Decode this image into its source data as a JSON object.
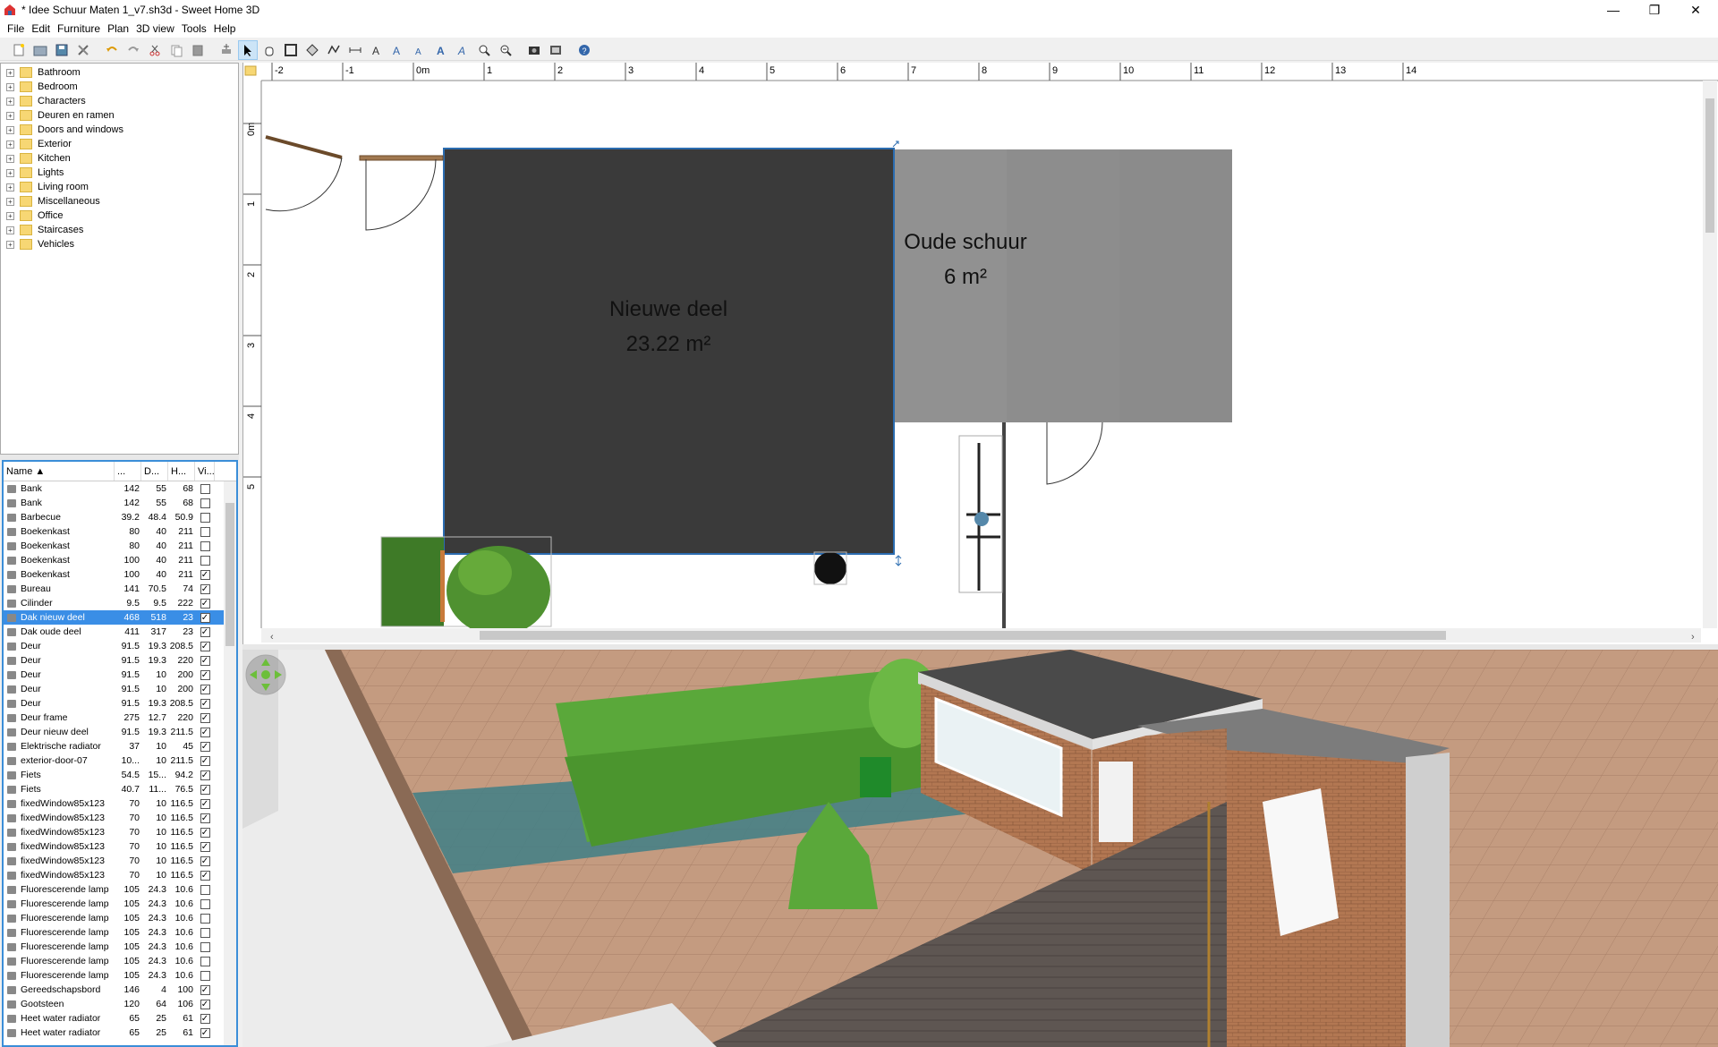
{
  "window": {
    "title": "* Idee Schuur Maten 1_v7.sh3d - Sweet Home 3D",
    "minimize": "—",
    "restore": "❐",
    "close": "✕"
  },
  "menu": [
    "File",
    "Edit",
    "Furniture",
    "Plan",
    "3D view",
    "Tools",
    "Help"
  ],
  "catalog": {
    "categories": [
      "Bathroom",
      "Bedroom",
      "Characters",
      "Deuren en ramen",
      "Doors and windows",
      "Exterior",
      "Kitchen",
      "Lights",
      "Living room",
      "Miscellaneous",
      "Office",
      "Staircases",
      "Vehicles"
    ]
  },
  "furniture_table": {
    "headers": [
      "Name ▲",
      "...",
      "D...",
      "H...",
      "Vi..."
    ],
    "rows": [
      {
        "name": "Bank",
        "w": "142",
        "d": "55",
        "h": "68",
        "visible": false
      },
      {
        "name": "Bank",
        "w": "142",
        "d": "55",
        "h": "68",
        "visible": false
      },
      {
        "name": "Barbecue",
        "w": "39.2",
        "d": "48.4",
        "h": "50.9",
        "visible": false
      },
      {
        "name": "Boekenkast",
        "w": "80",
        "d": "40",
        "h": "211",
        "visible": false
      },
      {
        "name": "Boekenkast",
        "w": "80",
        "d": "40",
        "h": "211",
        "visible": false
      },
      {
        "name": "Boekenkast",
        "w": "100",
        "d": "40",
        "h": "211",
        "visible": false
      },
      {
        "name": "Boekenkast",
        "w": "100",
        "d": "40",
        "h": "211",
        "visible": true
      },
      {
        "name": "Bureau",
        "w": "141",
        "d": "70.5",
        "h": "74",
        "visible": true
      },
      {
        "name": "Cilinder",
        "w": "9.5",
        "d": "9.5",
        "h": "222",
        "visible": true
      },
      {
        "name": "Dak nieuw deel",
        "w": "468",
        "d": "518",
        "h": "23",
        "visible": true,
        "selected": true
      },
      {
        "name": "Dak oude deel",
        "w": "411",
        "d": "317",
        "h": "23",
        "visible": true
      },
      {
        "name": "Deur",
        "w": "91.5",
        "d": "19.3",
        "h": "208.5",
        "visible": true
      },
      {
        "name": "Deur",
        "w": "91.5",
        "d": "19.3",
        "h": "220",
        "visible": true
      },
      {
        "name": "Deur",
        "w": "91.5",
        "d": "10",
        "h": "200",
        "visible": true
      },
      {
        "name": "Deur",
        "w": "91.5",
        "d": "10",
        "h": "200",
        "visible": true
      },
      {
        "name": "Deur",
        "w": "91.5",
        "d": "19.3",
        "h": "208.5",
        "visible": true
      },
      {
        "name": "Deur frame",
        "w": "275",
        "d": "12.7",
        "h": "220",
        "visible": true
      },
      {
        "name": "Deur nieuw deel",
        "w": "91.5",
        "d": "19.3",
        "h": "211.5",
        "visible": true
      },
      {
        "name": "Elektrische radiator",
        "w": "37",
        "d": "10",
        "h": "45",
        "visible": true
      },
      {
        "name": "exterior-door-07",
        "w": "10...",
        "d": "10",
        "h": "211.5",
        "visible": true
      },
      {
        "name": "Fiets",
        "w": "54.5",
        "d": "15...",
        "h": "94.2",
        "visible": true
      },
      {
        "name": "Fiets",
        "w": "40.7",
        "d": "11...",
        "h": "76.5",
        "visible": true
      },
      {
        "name": "fixedWindow85x123",
        "w": "70",
        "d": "10",
        "h": "116.5",
        "visible": true
      },
      {
        "name": "fixedWindow85x123",
        "w": "70",
        "d": "10",
        "h": "116.5",
        "visible": true
      },
      {
        "name": "fixedWindow85x123",
        "w": "70",
        "d": "10",
        "h": "116.5",
        "visible": true
      },
      {
        "name": "fixedWindow85x123",
        "w": "70",
        "d": "10",
        "h": "116.5",
        "visible": true
      },
      {
        "name": "fixedWindow85x123",
        "w": "70",
        "d": "10",
        "h": "116.5",
        "visible": true
      },
      {
        "name": "fixedWindow85x123",
        "w": "70",
        "d": "10",
        "h": "116.5",
        "visible": true
      },
      {
        "name": "Fluorescerende lamp",
        "w": "105",
        "d": "24.3",
        "h": "10.6",
        "visible": false
      },
      {
        "name": "Fluorescerende lamp",
        "w": "105",
        "d": "24.3",
        "h": "10.6",
        "visible": false
      },
      {
        "name": "Fluorescerende lamp",
        "w": "105",
        "d": "24.3",
        "h": "10.6",
        "visible": false
      },
      {
        "name": "Fluorescerende lamp",
        "w": "105",
        "d": "24.3",
        "h": "10.6",
        "visible": false
      },
      {
        "name": "Fluorescerende lamp",
        "w": "105",
        "d": "24.3",
        "h": "10.6",
        "visible": false
      },
      {
        "name": "Fluorescerende lamp",
        "w": "105",
        "d": "24.3",
        "h": "10.6",
        "visible": false
      },
      {
        "name": "Fluorescerende lamp",
        "w": "105",
        "d": "24.3",
        "h": "10.6",
        "visible": false
      },
      {
        "name": "Gereedschapsbord",
        "w": "146",
        "d": "4",
        "h": "100",
        "visible": true
      },
      {
        "name": "Gootsteen",
        "w": "120",
        "d": "64",
        "h": "106",
        "visible": true
      },
      {
        "name": "Heet water radiator",
        "w": "65",
        "d": "25",
        "h": "61",
        "visible": true
      },
      {
        "name": "Heet water radiator",
        "w": "65",
        "d": "25",
        "h": "61",
        "visible": true
      }
    ]
  },
  "plan": {
    "ruler_x": [
      "-2",
      "-1",
      "0m",
      "1",
      "2",
      "3",
      "4",
      "5",
      "6",
      "7",
      "8",
      "9",
      "10",
      "11",
      "12",
      "13",
      "14"
    ],
    "ruler_y": [
      "0m",
      "1",
      "2",
      "3",
      "4",
      "5"
    ],
    "rooms": [
      {
        "name": "Nieuwe deel",
        "area": "23.22 m²"
      },
      {
        "name": "Oude schuur",
        "area": "6 m²"
      }
    ]
  }
}
